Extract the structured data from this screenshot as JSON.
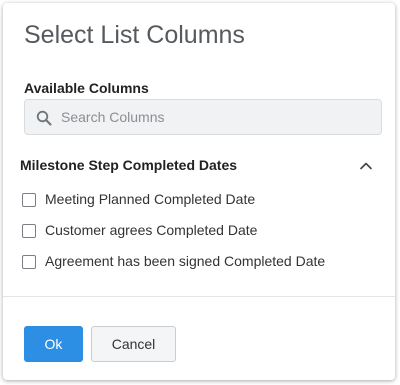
{
  "dialog": {
    "title": "Select List Columns"
  },
  "available": {
    "label": "Available Columns",
    "search": {
      "placeholder": "Search Columns",
      "value": ""
    }
  },
  "group": {
    "title": "Milestone Step Completed Dates",
    "expanded": true,
    "options": [
      {
        "label": "Meeting Planned Completed Date",
        "checked": false
      },
      {
        "label": "Customer agrees Completed Date",
        "checked": false
      },
      {
        "label": "Agreement has been signed Completed Date",
        "checked": false
      }
    ]
  },
  "footer": {
    "ok_label": "Ok",
    "cancel_label": "Cancel"
  },
  "colors": {
    "primary": "#2d8fe3",
    "title_text": "#555a5f",
    "search_bg": "#f1f2f3"
  }
}
